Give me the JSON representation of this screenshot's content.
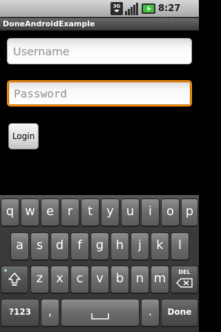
{
  "status_bar": {
    "network": "3G",
    "time": "8:27 PM",
    "icons": [
      "3g-icon",
      "signal-icon",
      "battery-charging-icon"
    ]
  },
  "app": {
    "title": "DoneAndroidExample"
  },
  "form": {
    "username": {
      "placeholder": "Username",
      "value": ""
    },
    "password": {
      "placeholder": "Password",
      "value": ""
    },
    "login_label": "Login"
  },
  "keyboard": {
    "row1": [
      "q",
      "w",
      "e",
      "r",
      "t",
      "y",
      "u",
      "i",
      "o",
      "p"
    ],
    "row2": [
      "a",
      "s",
      "d",
      "f",
      "g",
      "h",
      "j",
      "k",
      "l"
    ],
    "row3": [
      "z",
      "x",
      "c",
      "v",
      "b",
      "n",
      "m"
    ],
    "del_label": "DEL",
    "sym_label": "?123",
    "comma": ",",
    "period": ".",
    "done_label": "Done"
  },
  "colors": {
    "focus": "#ff9200",
    "background": "#000000"
  }
}
